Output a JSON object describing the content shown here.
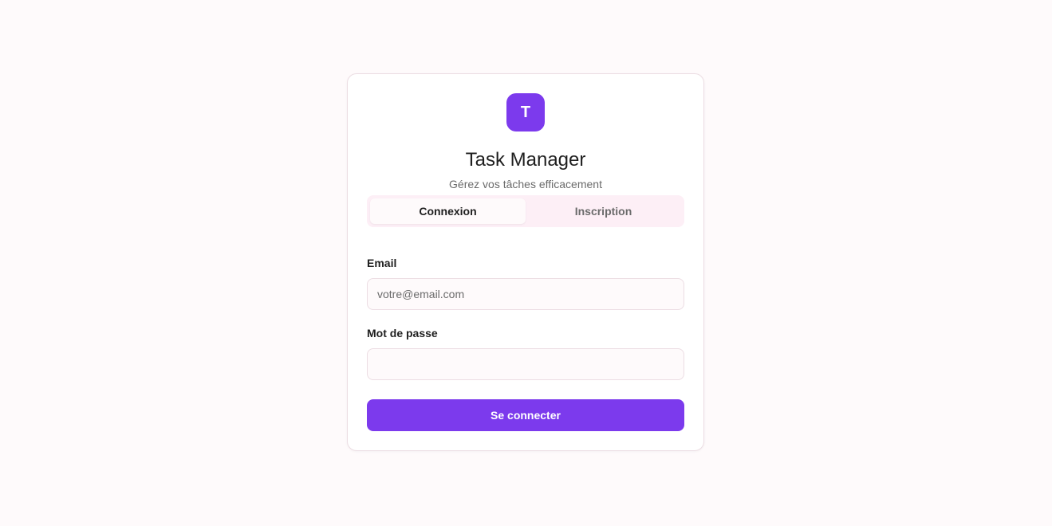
{
  "brand": {
    "logo_letter": "T",
    "accent_color": "#7c3aed",
    "title": "Task Manager",
    "subtitle": "Gérez vos tâches efficacement"
  },
  "tabs": [
    {
      "label": "Connexion",
      "active": true
    },
    {
      "label": "Inscription",
      "active": false
    }
  ],
  "form": {
    "email_label": "Email",
    "email_placeholder": "votre@email.com",
    "email_value": "",
    "password_label": "Mot de passe",
    "password_value": "",
    "submit_label": "Se connecter"
  }
}
